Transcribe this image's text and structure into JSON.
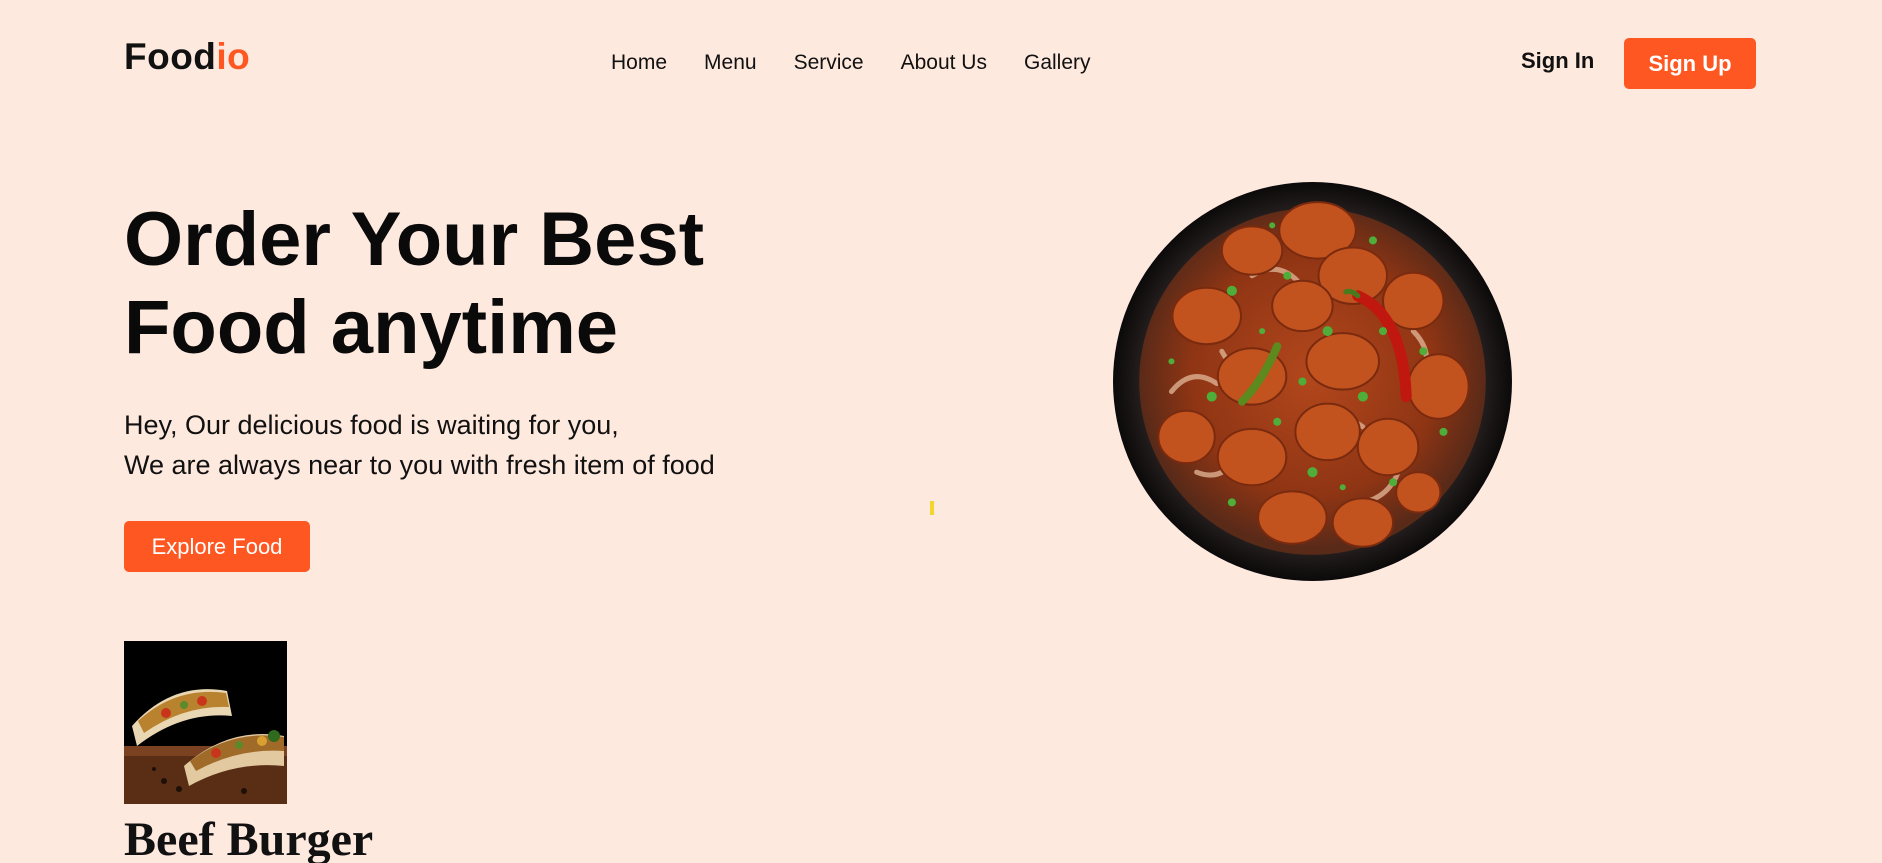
{
  "header": {
    "logo_main": "Food",
    "logo_accent": "io",
    "nav": [
      {
        "label": "Home"
      },
      {
        "label": "Menu"
      },
      {
        "label": "Service"
      },
      {
        "label": "About Us"
      },
      {
        "label": "Gallery"
      }
    ],
    "sign_in": "Sign In",
    "sign_up": "Sign Up"
  },
  "hero": {
    "title_line1": "Order Your Best",
    "title_line2": "Food anytime",
    "subtitle_line1": "Hey, Our delicious food is waiting for you,",
    "subtitle_line2": "We are always near to you with fresh item of food",
    "cta": "Explore Food",
    "image_icon": "chili-chicken-pan-image"
  },
  "food_card": {
    "title": "Beef Burger",
    "image_icon": "wrap-image"
  },
  "colors": {
    "accent": "#FF5722",
    "background": "#FEE9DF",
    "text": "#111111"
  }
}
